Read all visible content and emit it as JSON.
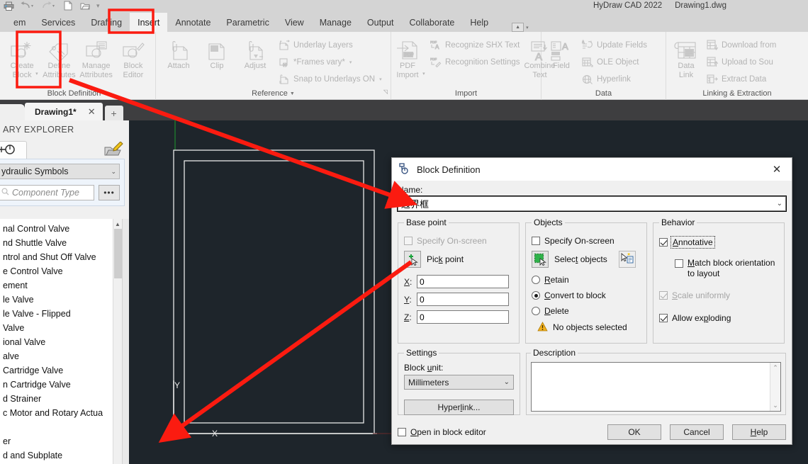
{
  "app": {
    "product": "HyDraw CAD 2022",
    "document": "Drawing1.dwg"
  },
  "quick_access": {
    "icons": [
      "print-icon",
      "undo-icon",
      "undo-caret",
      "redo-icon",
      "redo-caret",
      "new-file-icon",
      "open-folder-icon",
      "qat-overflow-caret"
    ]
  },
  "ribbon": {
    "tabs": [
      {
        "label": "em",
        "active": false
      },
      {
        "label": "Services",
        "active": false
      },
      {
        "label": "Drafting",
        "active": false
      },
      {
        "label": "Insert",
        "active": true
      },
      {
        "label": "Annotate",
        "active": false
      },
      {
        "label": "Parametric",
        "active": false
      },
      {
        "label": "View",
        "active": false
      },
      {
        "label": "Manage",
        "active": false
      },
      {
        "label": "Output",
        "active": false
      },
      {
        "label": "Collaborate",
        "active": false
      },
      {
        "label": "Help",
        "active": false
      }
    ],
    "panels": [
      {
        "title": "Block Definition",
        "has_caret": true,
        "big_buttons": [
          {
            "label_line1": "Create",
            "label_line2": "Block",
            "icon": "create-block-icon",
            "has_caret": true,
            "highlighted": true
          },
          {
            "label_line1": "Define",
            "label_line2": "Attributes",
            "icon": "define-attributes-icon",
            "has_caret": false
          },
          {
            "label_line1": "Manage",
            "label_line2": "Attributes",
            "icon": "manage-attributes-icon",
            "has_caret": false
          },
          {
            "label_line1": "Block",
            "label_line2": "Editor",
            "icon": "block-editor-icon",
            "has_caret": false
          }
        ]
      },
      {
        "title": "Reference",
        "has_caret": true,
        "has_expander": true,
        "big_buttons": [
          {
            "label_line1": "Attach",
            "label_line2": "",
            "icon": "attach-icon"
          },
          {
            "label_line1": "Clip",
            "label_line2": "",
            "icon": "clip-icon"
          },
          {
            "label_line1": "Adjust",
            "label_line2": "",
            "icon": "adjust-icon"
          }
        ],
        "small_buttons": [
          {
            "label": "Underlay Layers",
            "icon": "underlay-layers-icon",
            "has_caret": false
          },
          {
            "label": "*Frames vary*",
            "icon": "frames-vary-icon",
            "has_caret": true
          },
          {
            "label": "Snap to Underlays ON",
            "icon": "snap-underlays-icon",
            "has_caret": true
          }
        ]
      },
      {
        "title": "Import",
        "has_caret": false,
        "big_buttons": [
          {
            "label_line1": "PDF",
            "label_line2": "Import",
            "icon": "pdf-import-icon",
            "has_caret": true
          }
        ],
        "small_buttons": [
          {
            "label": "Recognize SHX Text",
            "icon": "recognize-shx-text-icon"
          },
          {
            "label": "Recognition Settings",
            "icon": "recognition-settings-icon"
          }
        ],
        "big_buttons_2": [
          {
            "label_line1": "Combine",
            "label_line2": "Text",
            "icon": "combine-text-icon"
          }
        ]
      },
      {
        "title": "Data",
        "has_caret": false,
        "big_buttons": [
          {
            "label_line1": "Field",
            "label_line2": "",
            "icon": "field-icon"
          }
        ],
        "small_buttons": [
          {
            "label": "Update Fields",
            "icon": "update-fields-icon"
          },
          {
            "label": "OLE Object",
            "icon": "ole-object-icon"
          },
          {
            "label": "Hyperlink",
            "icon": "hyperlink-icon"
          }
        ]
      },
      {
        "title": "Linking & Extraction",
        "has_caret": false,
        "big_buttons": [
          {
            "label_line1": "Data",
            "label_line2": "Link",
            "icon": "data-link-icon"
          }
        ],
        "small_buttons": [
          {
            "label": "Download from",
            "icon": "download-from-source-icon"
          },
          {
            "label": "Upload to Sou",
            "icon": "upload-to-source-icon"
          },
          {
            "label": "Extract  Data",
            "icon": "extract-data-icon"
          }
        ]
      }
    ]
  },
  "document_tabs": {
    "tabs": [
      {
        "label": "Drawing1*",
        "close": "✕",
        "active": true
      }
    ],
    "add_label": "+"
  },
  "library": {
    "header": "ARY EXPLORER",
    "tab_icon": "symbol-tab-icon",
    "edit_icon": "edit-library-icon",
    "category_value": "ydraulic Symbols",
    "search_placeholder": "Component Type",
    "more_button": "•••",
    "items": [
      "nal Control Valve",
      "nd Shuttle Valve",
      "ntrol and Shut Off Valve",
      "e Control Valve",
      "ement",
      "le Valve",
      "le Valve - Flipped",
      "Valve",
      "ional Valve",
      "alve",
      "Cartridge Valve",
      "n Cartridge Valve",
      "d Strainer",
      "c Motor and Rotary Actua",
      "",
      "er",
      "d and Subplate"
    ]
  },
  "dialog": {
    "title": "Block Definition",
    "title_icon": "block-definition-icon",
    "close_icon": "close-icon",
    "name_label": "Name:",
    "name_value": "边界框",
    "base_point": {
      "legend": "Base point",
      "specify_onscreen": {
        "label": "Specify On-screen",
        "checked": false,
        "disabled": true
      },
      "pick_point": {
        "label": "Pick point",
        "icon": "pick-point-icon"
      },
      "x": {
        "label": "X:",
        "value": "0"
      },
      "y": {
        "label": "Y:",
        "value": "0"
      },
      "z": {
        "label": "Z:",
        "value": "0"
      }
    },
    "objects": {
      "legend": "Objects",
      "specify_onscreen": {
        "label": "Specify On-screen",
        "checked": false
      },
      "select_objects": {
        "label": "Select objects",
        "icon": "select-objects-icon"
      },
      "quick_select": {
        "icon": "quick-select-icon"
      },
      "radios": [
        {
          "label": "Retain",
          "selected": false
        },
        {
          "label": "Convert to block",
          "selected": true
        },
        {
          "label": "Delete",
          "selected": false
        }
      ],
      "status": {
        "text": "No objects selected",
        "icon": "warning-icon",
        "color": "#f2b01e"
      }
    },
    "behavior": {
      "legend": "Behavior",
      "annotative": {
        "label": "Annotative",
        "checked": true,
        "focused": true
      },
      "match_orientation": {
        "label": "Match block orientation to layout",
        "checked": false
      },
      "scale_uniformly": {
        "label": "Scale uniformly",
        "checked": true,
        "disabled": true
      },
      "allow_exploding": {
        "label": "Allow exploding",
        "checked": true
      }
    },
    "settings": {
      "legend": "Settings",
      "block_unit_label": "Block unit:",
      "block_unit_value": "Millimeters",
      "hyperlink_button": "Hyperlink..."
    },
    "description": {
      "legend": "Description",
      "value": ""
    },
    "open_in_block_editor": {
      "label": "Open in block editor",
      "checked": false
    },
    "buttons": [
      {
        "label": "OK",
        "name": "ok-button"
      },
      {
        "label": "Cancel",
        "name": "cancel-button"
      },
      {
        "label": "Help",
        "name": "help-button"
      }
    ]
  },
  "annotations": {
    "color": "#fb1b10",
    "highlight_boxes": [
      "insert-tab",
      "create-block-button"
    ],
    "arrows": [
      "create-block-to-name-field",
      "name-field-to-base-point-origin"
    ]
  },
  "canvas": {
    "origin_marker": "ucs-origin-marker",
    "axis_labels": {
      "x": "X",
      "y": "Y"
    },
    "background": "#1e252b"
  }
}
